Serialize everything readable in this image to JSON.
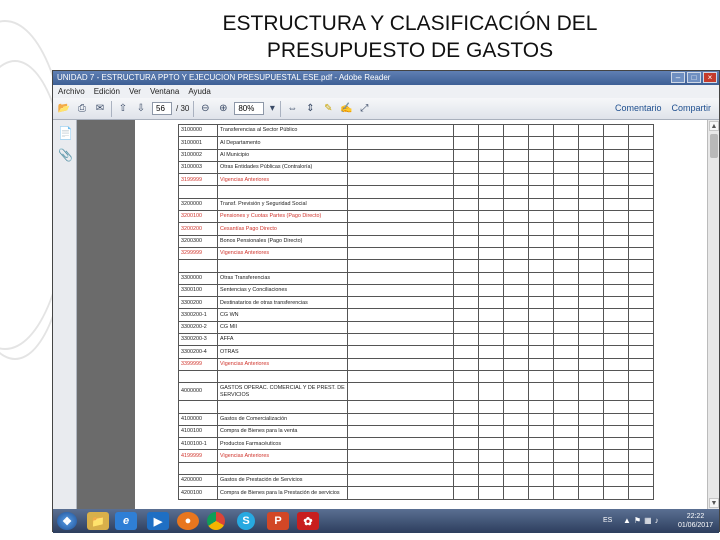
{
  "slide": {
    "title_line1": "ESTRUCTURA Y CLASIFICACIÓN DEL",
    "title_line2": "PRESUPUESTO DE GASTOS"
  },
  "window": {
    "title": "UNIDAD 7 - ESTRUCTURA PPTO Y EJECUCION PRESUPUESTAL ESE.pdf - Adobe Reader",
    "controls": [
      "–",
      "□",
      "×"
    ]
  },
  "menu": [
    "Archivo",
    "Edición",
    "Ver",
    "Ventana",
    "Ayuda"
  ],
  "toolbar": {
    "page_current": "56",
    "page_total": "/ 30",
    "zoom": "80%",
    "comment_label": "Comentario",
    "share_label": "Compartir",
    "icons": [
      "open-icon",
      "print-icon",
      "email-icon",
      "prev-page-icon",
      "next-page-icon",
      "zoom-out-icon",
      "zoom-in-icon",
      "fit-page-icon",
      "comment-icon",
      "sign-icon",
      "expand-icon"
    ]
  },
  "table": {
    "rows": [
      {
        "code": "3100000",
        "desc": "Transferencias al Sector Público",
        "style": ""
      },
      {
        "code": "3100001",
        "desc": "Al Departamento",
        "style": ""
      },
      {
        "code": "3100002",
        "desc": "Al Municipio",
        "style": ""
      },
      {
        "code": "3100003",
        "desc": "Otras Entidades Públicas (Contraloría)",
        "style": ""
      },
      {
        "code": "3199999",
        "desc": "Vigencias Anteriores",
        "style": "red"
      },
      {
        "code": "",
        "desc": "",
        "style": ""
      },
      {
        "code": "3200000",
        "desc": "Transf. Previsión y Seguridad Social",
        "style": ""
      },
      {
        "code": "3200100",
        "desc": "Pensiones y Cuotas Partes (Pago Directo)",
        "style": "red"
      },
      {
        "code": "3200200",
        "desc": "Cesantías Pago Directo",
        "style": "red"
      },
      {
        "code": "3200300",
        "desc": "Bonos Pensionales (Pago Directo)",
        "style": ""
      },
      {
        "code": "3299999",
        "desc": "Vigencias Anteriores",
        "style": "red"
      },
      {
        "code": "",
        "desc": "",
        "style": ""
      },
      {
        "code": "3300000",
        "desc": "Otras Transferencias",
        "style": ""
      },
      {
        "code": "3300100",
        "desc": "Sentencias y Conciliaciones",
        "style": ""
      },
      {
        "code": "3300200",
        "desc": "Destinatarios de otras transferencias",
        "style": ""
      },
      {
        "code": "3300200-1",
        "desc": "    CG WN",
        "style": ""
      },
      {
        "code": "3300200-2",
        "desc": "    CG MII",
        "style": ""
      },
      {
        "code": "3300200-3",
        "desc": "    AFFA",
        "style": ""
      },
      {
        "code": "3300200-4",
        "desc": "    OTRAS",
        "style": ""
      },
      {
        "code": "3399999",
        "desc": "Vigencias Anteriores",
        "style": "red"
      },
      {
        "code": "",
        "desc": "",
        "style": ""
      },
      {
        "code": "4000000",
        "desc": "GASTOS OPERAC. COMERCIAL Y DE PREST. DE SERVICIOS",
        "style": "tall"
      },
      {
        "code": "",
        "desc": "",
        "style": ""
      },
      {
        "code": "4100000",
        "desc": "Gastos de Comercialización",
        "style": ""
      },
      {
        "code": "4100100",
        "desc": "Compra de Bienes para la venta",
        "style": ""
      },
      {
        "code": "4100100-1",
        "desc": "    Productos Farmacéuticos",
        "style": ""
      },
      {
        "code": "4199999",
        "desc": "Vigencias Anteriores",
        "style": "red"
      },
      {
        "code": "",
        "desc": "",
        "style": ""
      },
      {
        "code": "4200000",
        "desc": "Gastos de Prestación de Servicios",
        "style": ""
      },
      {
        "code": "4200100",
        "desc": "Compra de Bienes para la Prestación de servicios",
        "style": ""
      }
    ]
  },
  "taskbar": {
    "apps": [
      "start-icon",
      "file-explorer-icon",
      "internet-explorer-icon",
      "media-player-icon",
      "firefox-icon",
      "chrome-icon",
      "skype-icon",
      "powerpoint-icon",
      "acrobat-reader-icon"
    ],
    "language": "ES",
    "time": "22:22",
    "date": "01/06/2017"
  },
  "colors": {
    "red_text": "#d0342c",
    "titlebar": "#3d5f95",
    "taskbar": "#2d3e5e"
  }
}
